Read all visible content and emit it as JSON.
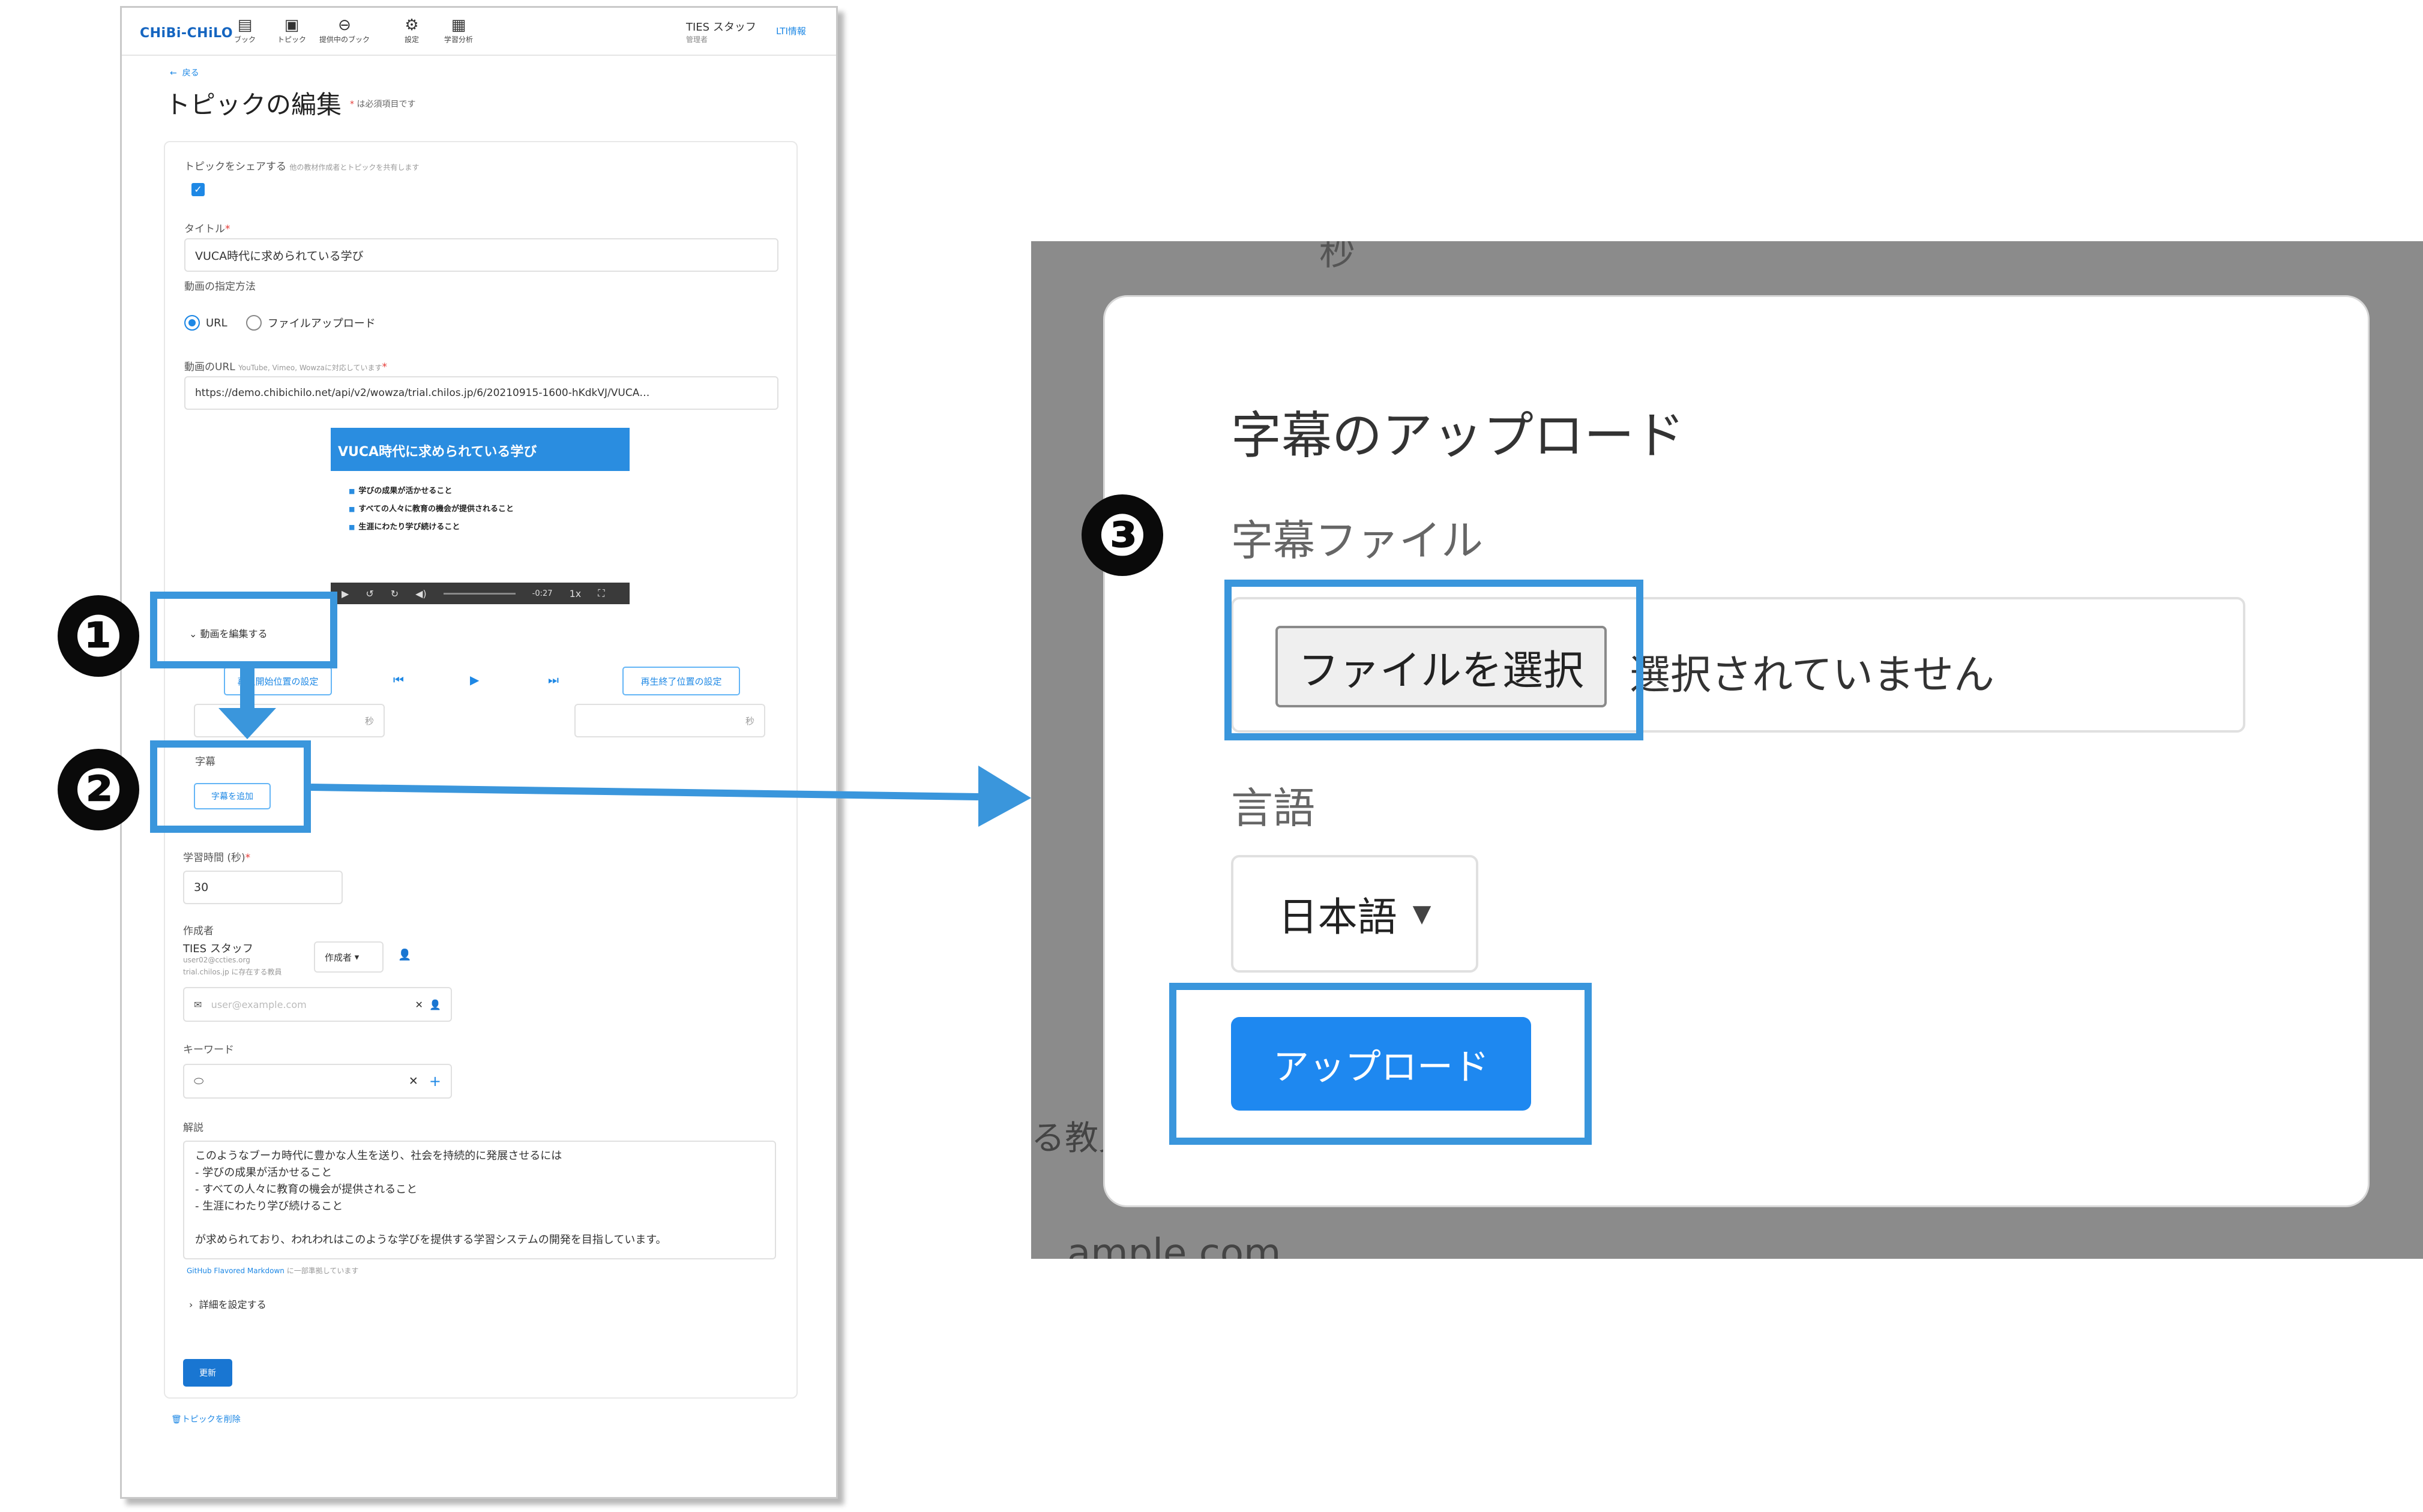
{
  "app": {
    "logo": "CHiBi-CHiLO",
    "nav": [
      {
        "icon": "book-icon",
        "glyph": "▤",
        "label": "ブック"
      },
      {
        "icon": "topic-icon",
        "glyph": "▣",
        "label": "トピック"
      },
      {
        "icon": "link-icon",
        "glyph": "⊖",
        "label": "提供中のブック"
      },
      {
        "icon": "gear-icon",
        "glyph": "⚙",
        "label": "設定"
      },
      {
        "icon": "analytics-icon",
        "glyph": "▦",
        "label": "学習分析"
      }
    ],
    "user_name": "TIES スタッフ",
    "user_role": "管理者",
    "lti_link": "LTI情報"
  },
  "page": {
    "back_label": "戻る",
    "title": "トピックの編集",
    "required_note_mark": "*",
    "required_note": "は必須項目です"
  },
  "form": {
    "share_label": "トピックをシェアする",
    "share_hint": "他の教材作成者とトピックを共有します",
    "title_label": "タイトル",
    "title_value": "VUCA時代に求められている学び",
    "video_method_label": "動画の指定方法",
    "radio_url": "URL",
    "radio_upload": "ファイルアップロード",
    "video_url_label": "動画のURL",
    "video_url_hint": "YouTube, Vimeo, Wowzaに対応しています",
    "video_url_value": "https://demo.chibichilo.net/api/v2/wowza/trial.chilos.jp/6/20210915-1600-hKdkVJ/VUCA…",
    "video_heading": "VUCA時代に求められている学び",
    "video_bullets": [
      "学びの成果が活かせること",
      "すべての人々に教育の機会が提供されること",
      "生涯にわたり学び続けること"
    ],
    "video_time": "-0:27",
    "video_speed": "1x",
    "edit_video_label": "動画を編集する",
    "start_pos_button": "再生開始位置の設定",
    "end_pos_button": "再生終了位置の設定",
    "seconds_unit": "秒",
    "subtitle_label": "字幕",
    "add_subtitle_button": "字幕を追加",
    "study_time_label": "学習時間 (秒)",
    "study_time_value": "30",
    "author_label": "作成者",
    "author_name": "TIES スタッフ",
    "author_email": "user02@ccties.org",
    "author_note": "trial.chilos.jp に存在する教員",
    "author_role": "作成者",
    "email_placeholder": "user@example.com",
    "keyword_label": "キーワード",
    "description_label": "解説",
    "description": "このようなブーカ時代に豊かな人生を送り、社会を持続的に発展させるには\n- 学びの成果が活かせること\n- すべての人々に教育の機会が提供されること\n- 生涯にわたり学び続けること\n\nが求められており、われわれはこのような学びを提供する学習システムの開発を目指しています。",
    "markdown_link": "GitHub Flavored Markdown",
    "markdown_note": "に一部準拠しています",
    "advanced_label": "詳細を設定する",
    "update_button": "更新",
    "delete_link": "トピックを削除"
  },
  "dialog": {
    "bg_fragment_top": "秒",
    "bg_fragment_left": "る教員",
    "bg_fragment_bottom": "ample.com",
    "title": "字幕のアップロード",
    "file_label": "字幕ファイル",
    "choose_file_button": "ファイルを選択",
    "no_file_text": "選択されていません",
    "language_label": "言語",
    "language_value": "日本語",
    "upload_button": "アップロード"
  },
  "annotations": {
    "step1": "❶",
    "step2": "❷",
    "step3": "❸",
    "highlight_color": "#3a96dc"
  }
}
